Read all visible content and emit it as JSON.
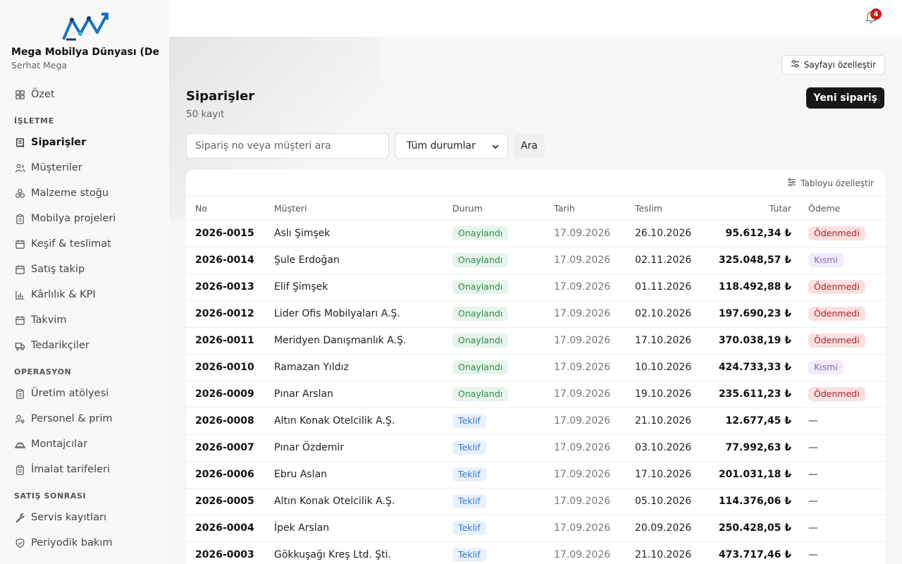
{
  "sidebar": {
    "company": "Mega Mobilya Dünyası (De...",
    "user": "Serhat Mega",
    "top_item": "Özet",
    "sections": [
      {
        "title": "İŞLETME",
        "items": [
          "Siparişler",
          "Müşteriler",
          "Malzeme stoğu",
          "Mobilya projeleri",
          "Keşif & teslimat",
          "Satış takip",
          "Kârlılık & KPI",
          "Takvim",
          "Tedarikçiler"
        ]
      },
      {
        "title": "OPERASYON",
        "items": [
          "Üretim atölyesi",
          "Personel & prim",
          "Montajcılar",
          "İmalat tarifeleri"
        ]
      },
      {
        "title": "SATIŞ SONRASI",
        "items": [
          "Servis kayıtları",
          "Periyodik bakım"
        ]
      }
    ],
    "active_item": "Siparişler"
  },
  "topbar": {
    "notification_count": "4"
  },
  "page": {
    "customize_label": "Sayfayı özelleştir",
    "title": "Siparişler",
    "record_count": "50 kayıt",
    "new_order_label": "Yeni sipariş",
    "search_placeholder": "Sipariş no veya müşteri ara",
    "status_filter": "Tüm durumlar",
    "search_button": "Ara",
    "table_customize_label": "Tabloyu özelleştir"
  },
  "table": {
    "headers": {
      "no": "No",
      "customer": "Müşteri",
      "status": "Durum",
      "date": "Tarih",
      "delivery": "Teslim",
      "amount": "Tutar",
      "payment": "Ödeme"
    },
    "rows": [
      {
        "no": "2026-0015",
        "customer": "Aslı Şimşek",
        "status": "Onaylandı",
        "date": "17.09.2026",
        "delivery": "26.10.2026",
        "amount": "95.612,34 ₺",
        "payment": "Ödenmedi"
      },
      {
        "no": "2026-0014",
        "customer": "Şule Erdoğan",
        "status": "Onaylandı",
        "date": "17.09.2026",
        "delivery": "02.11.2026",
        "amount": "325.048,57 ₺",
        "payment": "Kısmi"
      },
      {
        "no": "2026-0013",
        "customer": "Elif Şimşek",
        "status": "Onaylandı",
        "date": "17.09.2026",
        "delivery": "01.11.2026",
        "amount": "118.492,88 ₺",
        "payment": "Ödenmedi"
      },
      {
        "no": "2026-0012",
        "customer": "Lider Ofis Mobilyaları A.Ş.",
        "status": "Onaylandı",
        "date": "17.09.2026",
        "delivery": "02.10.2026",
        "amount": "197.690,23 ₺",
        "payment": "Ödenmedi"
      },
      {
        "no": "2026-0011",
        "customer": "Meridyen Danışmanlık A.Ş.",
        "status": "Onaylandı",
        "date": "17.09.2026",
        "delivery": "17.10.2026",
        "amount": "370.038,19 ₺",
        "payment": "Ödenmedi"
      },
      {
        "no": "2026-0010",
        "customer": "Ramazan Yıldız",
        "status": "Onaylandı",
        "date": "17.09.2026",
        "delivery": "10.10.2026",
        "amount": "424.733,33 ₺",
        "payment": "Kısmi"
      },
      {
        "no": "2026-0009",
        "customer": "Pınar Arslan",
        "status": "Onaylandı",
        "date": "17.09.2026",
        "delivery": "19.10.2026",
        "amount": "235.611,23 ₺",
        "payment": "Ödenmedi"
      },
      {
        "no": "2026-0008",
        "customer": "Altın Konak Otelcilik A.Ş.",
        "status": "Teklif",
        "date": "17.09.2026",
        "delivery": "21.10.2026",
        "amount": "12.677,45 ₺",
        "payment": "—"
      },
      {
        "no": "2026-0007",
        "customer": "Pınar Özdemir",
        "status": "Teklif",
        "date": "17.09.2026",
        "delivery": "03.10.2026",
        "amount": "77.992,63 ₺",
        "payment": "—"
      },
      {
        "no": "2026-0006",
        "customer": "Ebru Aslan",
        "status": "Teklif",
        "date": "17.09.2026",
        "delivery": "17.10.2026",
        "amount": "201.031,18 ₺",
        "payment": "—"
      },
      {
        "no": "2026-0005",
        "customer": "Altın Konak Otelcilik A.Ş.",
        "status": "Teklif",
        "date": "17.09.2026",
        "delivery": "05.10.2026",
        "amount": "114.376,06 ₺",
        "payment": "—"
      },
      {
        "no": "2026-0004",
        "customer": "İpek Arslan",
        "status": "Teklif",
        "date": "17.09.2026",
        "delivery": "20.09.2026",
        "amount": "250.428,05 ₺",
        "payment": "—"
      },
      {
        "no": "2026-0003",
        "customer": "Gökkuşağı Kreş Ltd. Şti.",
        "status": "Teklif",
        "date": "17.09.2026",
        "delivery": "21.10.2026",
        "amount": "473.717,46 ₺",
        "payment": "—"
      }
    ]
  },
  "icons": {
    "top_item": "dashboard-icon",
    "İŞLETME": [
      "receipt-icon",
      "users-icon",
      "boxes-icon",
      "clipboard-icon",
      "calendar-icon",
      "calendar-icon",
      "bar-chart-icon",
      "calendar-icon",
      "truck-icon"
    ],
    "OPERASYON": [
      "clipboard-icon",
      "user-key-icon",
      "hard-hat-icon",
      "clipboard-icon"
    ],
    "SATIŞ SONRASI": [
      "wrench-icon",
      "shield-check-icon"
    ]
  },
  "colors": {
    "primary_button": "#181818",
    "approved": "#2e8b4e",
    "offer": "#3a7bc8",
    "unpaid": "#b01e2a",
    "partial": "#8a6bc2",
    "badge": "#d11a1a"
  }
}
